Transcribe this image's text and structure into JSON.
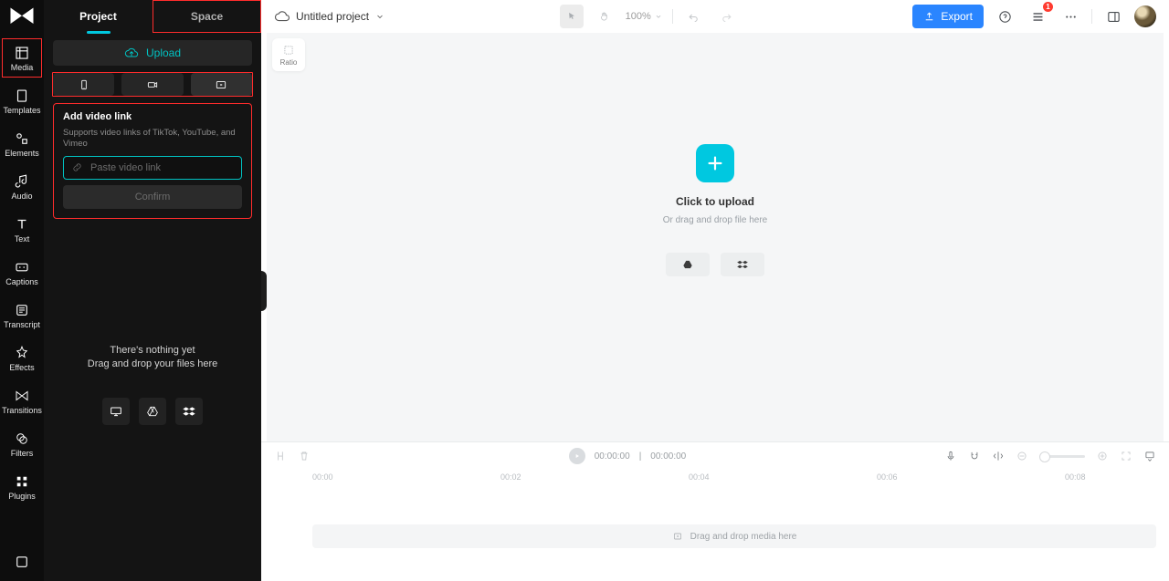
{
  "rail": {
    "items": [
      {
        "label": "Media"
      },
      {
        "label": "Templates"
      },
      {
        "label": "Elements"
      },
      {
        "label": "Audio"
      },
      {
        "label": "Text"
      },
      {
        "label": "Captions"
      },
      {
        "label": "Transcript"
      },
      {
        "label": "Effects"
      },
      {
        "label": "Transitions"
      },
      {
        "label": "Filters"
      },
      {
        "label": "Plugins"
      }
    ]
  },
  "panel": {
    "tabs": {
      "project": "Project",
      "space": "Space"
    },
    "upload_label": "Upload",
    "add_link": {
      "title": "Add video link",
      "subtitle": "Supports video links of TikTok, YouTube, and Vimeo",
      "placeholder": "Paste video link",
      "confirm": "Confirm"
    },
    "empty": {
      "line1": "There's nothing yet",
      "line2": "Drag and drop your files here"
    }
  },
  "topbar": {
    "project_title": "Untitled project",
    "zoom": "100%",
    "export": "Export",
    "notif_count": "1"
  },
  "canvas": {
    "ratio_label": "Ratio",
    "cta_title": "Click to upload",
    "cta_sub": "Or drag and drop file here"
  },
  "timeline": {
    "time_current": "00:00:00",
    "time_total": "00:00:00",
    "ticks": [
      "00:00",
      "00:02",
      "00:04",
      "00:06",
      "00:08"
    ],
    "dropzone": "Drag and drop media here"
  }
}
